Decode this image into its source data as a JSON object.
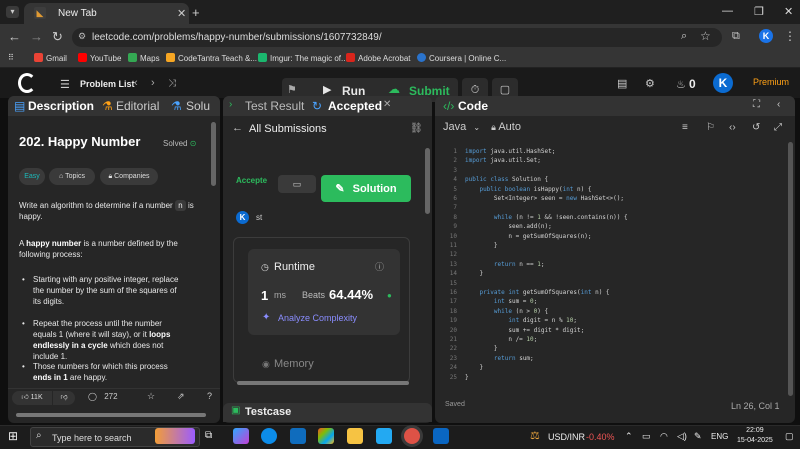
{
  "browser": {
    "tab_title": "New Tab",
    "url": "leetcode.com/problems/happy-number/submissions/1607732849/",
    "profile_initial": "K",
    "bookmarks": [
      "Gmail",
      "YouTube",
      "Maps",
      "CodeTantra Teach &...",
      "Imgur: The magic of...",
      "Adobe Acrobat",
      "Coursera | Online C..."
    ]
  },
  "header": {
    "problem_list": "Problem List",
    "run": "Run",
    "submit": "Submit",
    "streak": "0",
    "avatar": "K",
    "premium": "Premium"
  },
  "description": {
    "tab_description": "Description",
    "tab_editorial": "Editorial",
    "tab_solutions": "Solu",
    "title": "202. Happy Number",
    "solved": "Solved",
    "difficulty": "Easy",
    "topics": "Topics",
    "companies": "Companies",
    "para1_a": "Write an algorithm to determine if a number",
    "para1_n": "n",
    "para1_b": "is happy.",
    "para2_a": "A",
    "para2_b": "happy number",
    "para2_c": "is a number defined by the following process:",
    "bullet1": "Starting with any positive integer, replace the number by the sum of the squares of its digits.",
    "bullet2_a": "Repeat the process until the number equals 1 (where it will stay), or it",
    "bullet2_b": "loops endlessly in a cycle",
    "bullet2_c": "which does not include 1.",
    "bullet3_a": "Those numbers for which this process",
    "bullet3_b": "ends in 1",
    "bullet3_c": "are happy.",
    "likes": "11K",
    "comments": "272"
  },
  "submission": {
    "tab_test_result": "Test Result",
    "tab_accepted": "Accepted",
    "all_submissions": "All Submissions",
    "status": "Accepte",
    "solution_button": "Solution",
    "user_initial": "K",
    "user_name": "st",
    "runtime_label": "Runtime",
    "runtime_value": "1",
    "runtime_unit": "ms",
    "beats_label": "Beats",
    "beats_value": "64.44%",
    "analyze": "Analyze Complexity",
    "memory_label": "Memory",
    "testcase": "Testcase"
  },
  "code": {
    "tab_code": "Code",
    "language": "Java",
    "mode": "Auto",
    "lines": [
      "import java.util.HashSet;",
      "import java.util.Set;",
      "",
      "public class Solution {",
      "    public boolean isHappy(int n) {",
      "        Set<Integer> seen = new HashSet<>();",
      "",
      "        while (n != 1 && !seen.contains(n)) {",
      "            seen.add(n);",
      "            n = getSumOfSquares(n);",
      "        }",
      "",
      "        return n == 1;",
      "    }",
      "",
      "    private int getSumOfSquares(int n) {",
      "        int sum = 0;",
      "        while (n > 0) {",
      "            int digit = n % 10;",
      "            sum += digit * digit;",
      "            n /= 10;",
      "        }",
      "        return sum;",
      "    }",
      "}"
    ],
    "saved": "Saved",
    "cursor": "Ln 26, Col 1"
  },
  "taskbar": {
    "search_placeholder": "Type here to search",
    "ticker": "USD/INR",
    "ticker_change": "-0.40%",
    "language": "ENG",
    "time": "22:09",
    "date": "15-04-2025"
  },
  "colors": {
    "accent_green": "#2cbb5d",
    "brand_orange": "#ffa116",
    "blue": "#1a73e8"
  }
}
